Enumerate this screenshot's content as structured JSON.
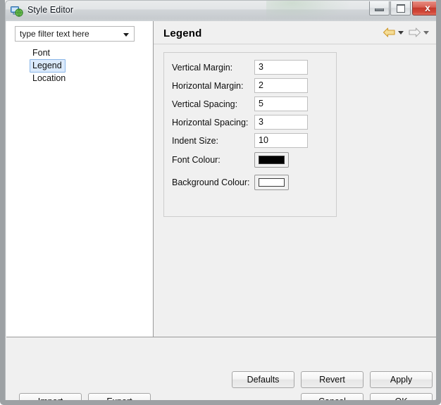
{
  "window": {
    "title": "Style Editor",
    "icon": "network-globe-icon",
    "controls": {
      "minimize_label": "Minimize",
      "maximize_label": "Maximize",
      "close_label": "x"
    }
  },
  "sidebar": {
    "filter": {
      "value": "type filter text here",
      "placeholder": "type filter text here"
    },
    "items": [
      {
        "label": "Font",
        "selected": false
      },
      {
        "label": "Legend",
        "selected": true
      },
      {
        "label": "Location",
        "selected": false
      }
    ]
  },
  "detail": {
    "title": "Legend",
    "nav": {
      "back_icon": "back-arrow-icon",
      "back_menu_icon": "chevron-down-icon",
      "forward_icon": "forward-arrow-icon",
      "forward_menu_icon": "chevron-down-icon"
    },
    "fields": [
      {
        "label": "Vertical Margin:",
        "value": "3",
        "type": "text"
      },
      {
        "label": "Horizontal Margin:",
        "value": "2",
        "type": "text"
      },
      {
        "label": "Vertical Spacing:",
        "value": "5",
        "type": "text"
      },
      {
        "label": "Horizontal Spacing:",
        "value": "3",
        "type": "text"
      },
      {
        "label": "Indent Size:",
        "value": "10",
        "type": "text"
      },
      {
        "label": "Font Colour:",
        "value": "#000000",
        "type": "colour"
      },
      {
        "label": "Background Colour:",
        "value": "#ffffff",
        "type": "colour"
      }
    ]
  },
  "buttons": {
    "defaults": "Defaults",
    "revert": "Revert",
    "apply": "Apply",
    "cancel": "Cancel",
    "ok": "OK",
    "import": "Import",
    "export": "Export"
  },
  "colors": {
    "accent_back_arrow": "#f2d98b",
    "accent_back_arrow_border": "#c9952f",
    "forward_arrow": "#f2f2f2",
    "forward_arrow_border": "#a9a9a9",
    "selection_bg": "#dbeafc",
    "selection_border": "#8ab6e8",
    "close_button": "#c33a2c",
    "panel_bg": "#f0f0f0",
    "tree_bg": "#ffffff"
  }
}
